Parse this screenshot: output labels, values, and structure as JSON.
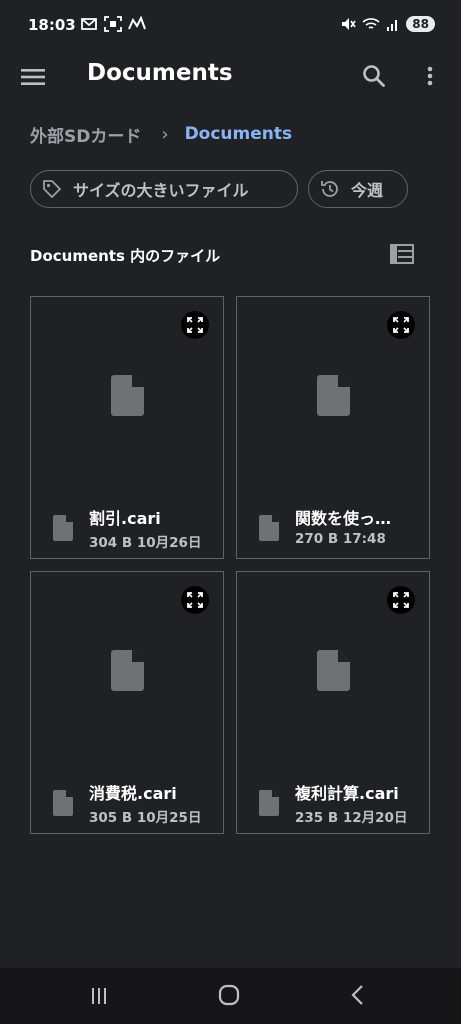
{
  "status_bar": {
    "time": "18:03",
    "left_icons": [
      "message-icon",
      "screenshot-icon",
      "app-icon"
    ],
    "right_icons": [
      "mute-icon",
      "wifi-icon",
      "signal-icon"
    ],
    "battery": "88"
  },
  "app_bar": {
    "title": "Documents",
    "menu_icon": "menu-icon",
    "search_icon": "search-icon",
    "more_icon": "more-vert-icon"
  },
  "breadcrumb": {
    "root": "外部SDカード",
    "separator": "›",
    "current": "Documents"
  },
  "filters": [
    {
      "label": "サイズの大きいファイル",
      "icon": "label-icon"
    },
    {
      "label": "今週",
      "icon": "history-icon"
    }
  ],
  "section": {
    "title": "Documents 内のファイル",
    "view_icon": "list-view-icon"
  },
  "files": [
    {
      "name": "割引.cari",
      "size": "304 B",
      "date": "10月26日"
    },
    {
      "name": "関数を使っ…",
      "size": "270 B",
      "date": "17:48"
    },
    {
      "name": "消費税.cari",
      "size": "305 B",
      "date": "10月25日"
    },
    {
      "name": "複利計算.cari",
      "size": "235 B",
      "date": "12月20日"
    }
  ],
  "nav_bar": [
    "recents-icon",
    "home-icon",
    "back-icon"
  ],
  "colors": {
    "background": "#202124",
    "accent": "#8ab4f8",
    "border": "#5f6368"
  }
}
